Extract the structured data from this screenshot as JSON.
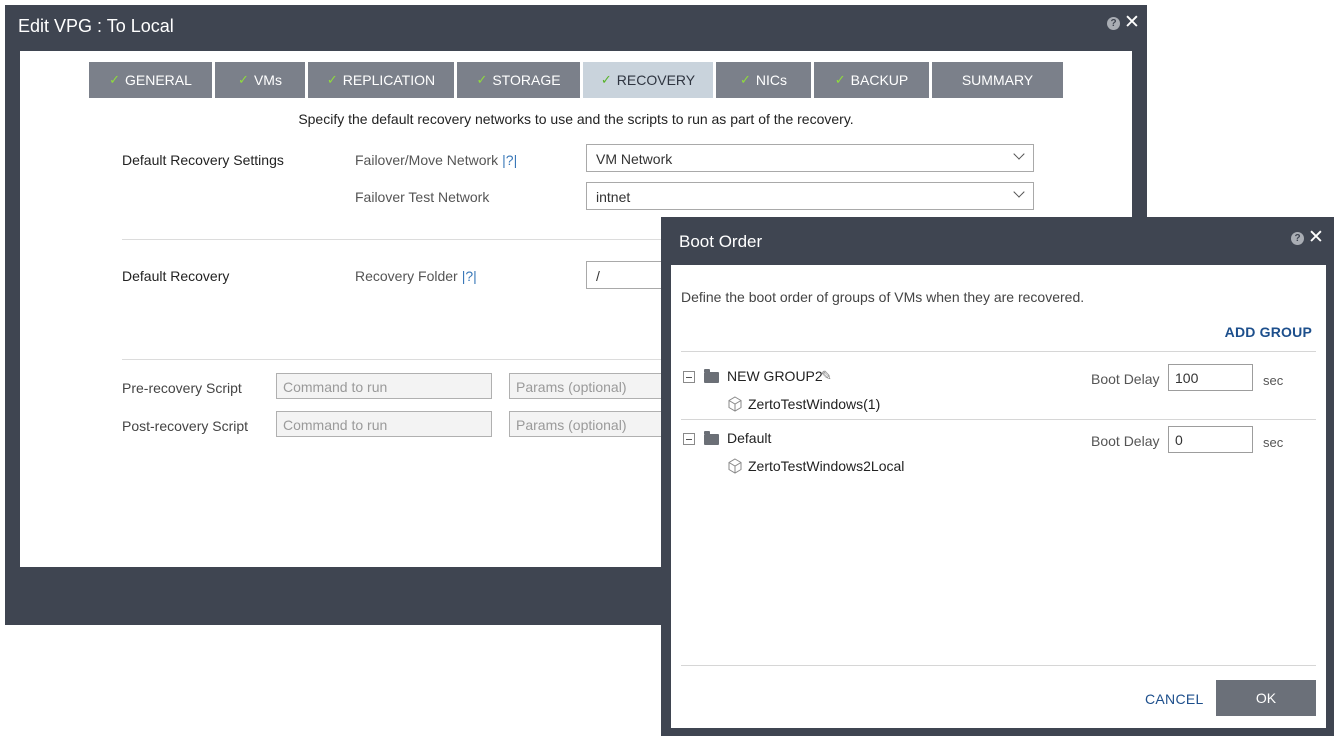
{
  "vpg": {
    "title": "Edit VPG : To Local",
    "help": "?",
    "close": "✕",
    "tabs": [
      {
        "label": "GENERAL",
        "check": "✓"
      },
      {
        "label": "VMs",
        "check": "✓"
      },
      {
        "label": "REPLICATION",
        "check": "✓"
      },
      {
        "label": "STORAGE",
        "check": "✓"
      },
      {
        "label": "RECOVERY",
        "check": "✓"
      },
      {
        "label": "NICs",
        "check": "✓"
      },
      {
        "label": "BACKUP",
        "check": "✓"
      },
      {
        "label": "SUMMARY"
      }
    ],
    "intro": "Specify the default recovery networks to use and the scripts to run as part of the recovery.",
    "default_settings": {
      "section_label": "Default Recovery Settings",
      "failover_label": "Failover/Move Network",
      "failover_help": "|?|",
      "failover_value": "VM Network",
      "test_label": "Failover Test Network",
      "test_value": "intnet"
    },
    "default_recovery": {
      "section_label": "Default Recovery",
      "folder_label": "Recovery Folder",
      "folder_help": "|?|",
      "folder_value": "/"
    },
    "scripts": {
      "pre_label": "Pre-recovery Script",
      "post_label": "Post-recovery Script",
      "command_placeholder": "Command to run",
      "params_placeholder": "Params (optional)"
    }
  },
  "boot": {
    "title": "Boot Order",
    "help": "?",
    "close": "✕",
    "description": "Define the boot order of groups of VMs when they are recovered.",
    "add_group": "ADD GROUP",
    "boot_delay_label": "Boot Delay",
    "unit": "sec",
    "groups": [
      {
        "name": "NEW GROUP2",
        "delay": "100",
        "vm": "ZertoTestWindows(1)"
      },
      {
        "name": "Default",
        "delay": "0",
        "vm": "ZertoTestWindows2Local"
      }
    ],
    "cancel": "CANCEL",
    "ok": "OK"
  }
}
